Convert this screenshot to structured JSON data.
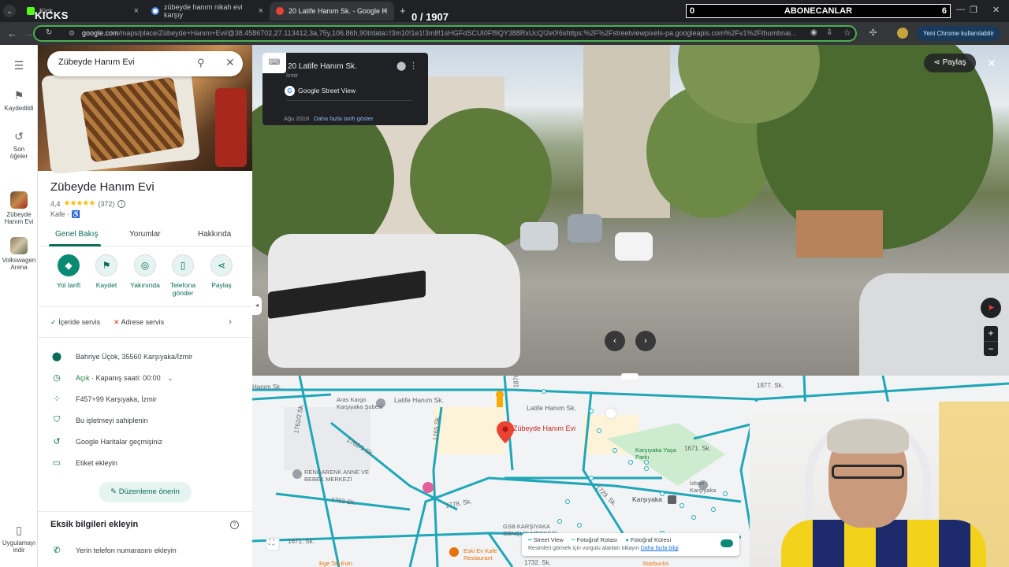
{
  "browser": {
    "tabs": [
      {
        "label": "Kick",
        "close": "×",
        "color": "#53fc18"
      },
      {
        "label": "zübeyde hanım nikah evi karşıy",
        "close": "×",
        "color": "#4285f4"
      },
      {
        "label": "20 Latife Hanım Sk. - Google H",
        "close": "×",
        "color": "#ea4335"
      }
    ],
    "new_tab": "+",
    "url_host": "google.com",
    "url_rest": "/maps/place/Zübeyde+Hanım+Evi/@38.4586702,27.113412,3a,75y,106.86h,90t/data=!3m10!1e1!3m8!1sHGFdSCUI0Ff9QY388RxUcQ!2e0!6shttps:%2F%2Fstreetviewpixels-pa.googleapis.com%2Fv1%2Fthumbnai...",
    "promo": "Yeni Chrome kullanılabilir"
  },
  "overlay": {
    "kicks": "KICKS",
    "counter": "0 / 1907",
    "sub_left": "0",
    "sub_title": "ABONECANLAR",
    "sub_right": "6"
  },
  "rail": {
    "saved": "Kaydedildi",
    "recent": "Son öğeler",
    "place1": "Zübeyde Hanım Evi",
    "place2": "Volkswagen Arena",
    "app": "Uygulamayı indir"
  },
  "search": {
    "value": "Zübeyde Hanım Evi"
  },
  "place": {
    "title": "Zübeyde Hanım Evi",
    "rating": "4,4",
    "stars": "★★★★★",
    "reviews": "(372)",
    "category": "Kafe ·",
    "accessible": "♿",
    "tabs": [
      "Genel Bakış",
      "Yorumlar",
      "Hakkında"
    ],
    "actions": [
      {
        "label": "Yol tarifi",
        "icon": "◆"
      },
      {
        "label": "Kaydet",
        "icon": "⚑"
      },
      {
        "label": "Yakınında",
        "icon": "◎"
      },
      {
        "label": "Telefona gönder",
        "icon": "▯"
      },
      {
        "label": "Paylaş",
        "icon": "⋖"
      }
    ],
    "service_in": "İçeride servis",
    "service_out": "Adrese servis",
    "address": "Bahriye Üçok, 35560 Karşıyaka/İzmir",
    "open": "Açık",
    "hours": "· Kapanış saati: 00:00",
    "plus_code": "F457+99 Karşıyaka, İzmir",
    "claim": "Bu işletmeyi sahiplenin",
    "history": "Google Haritalar geçmişiniz",
    "label": "Etiket ekleyin",
    "suggest": "Düzenleme önerin",
    "missing": "Eksik bilgileri ekleyin",
    "add_phone": "Yerin telefon numarasını ekleyin"
  },
  "streetview": {
    "address": "20 Latife Hanım Sk.",
    "city": "İzmir",
    "source": "Google Street View",
    "date": "Ağu 2018",
    "more_dates": "Daha fazla tarih göster",
    "share": "Paylaş"
  },
  "map": {
    "streets": [
      "Hanım Sk.",
      "Latife Hanım Sk.",
      "Latife Hanım Sk.",
      "1762/2 Sk.",
      "1765 Sk.",
      "1762/1 Sk.",
      "1763 Sk.",
      "1778. Sk.",
      "1729. Sk.",
      "1671. Sk.",
      "1877. Sk.",
      "1671. Sk.",
      "1732. Sk.",
      "1876"
    ],
    "pois": [
      "Aras Kargo Karşıyaka Şubesi",
      "Zübeyde Hanım Evi",
      "Karşıyaka Yaşa Parkı",
      "RENGARENK ANNE VE BEBEK MERKEZİ",
      "GSB KARŞIYAKA GENÇLİK MERKEZİ",
      "Karşıyaka",
      "İzban Karşıyaka",
      "Eski Ev Kafe Restaurant",
      "Ege Tat Evin",
      "Starbucks"
    ],
    "legend_sv": "Street View",
    "legend_route": "Fotoğraf Rotası",
    "legend_sphere": "Fotoğraf Küresi",
    "legend_note": "Resimleri görmek için vurgulu alanları tıklayın",
    "legend_more": "Daha fazla bilgi"
  }
}
